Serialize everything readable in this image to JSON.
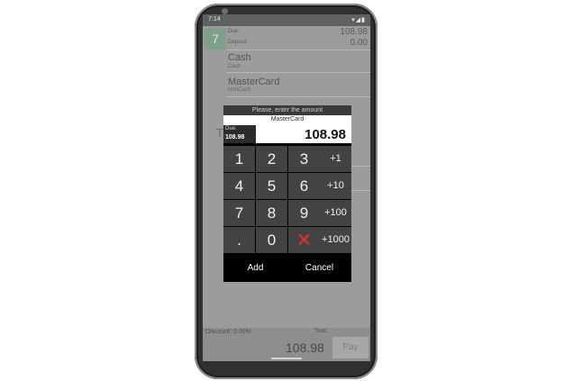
{
  "status": {
    "time": "7:14",
    "icons": "▾◢▮"
  },
  "back": {
    "label": "7"
  },
  "summary": {
    "due_label": "Due:",
    "due_value": "108.98",
    "deposit_label": "Deposit:",
    "deposit_value": "0.00"
  },
  "payment_methods": [
    {
      "name": "Cash",
      "type": "Cash"
    },
    {
      "name": "MasterCard",
      "type": "NonCash"
    }
  ],
  "background_letter": "T",
  "footer": {
    "discount_label": "Discount: 0.00%",
    "total_label": "Total:",
    "total_value": "108.98",
    "pay_label": "Pay"
  },
  "dialog": {
    "title": "Please, enter the amount",
    "card_name": "MasterCard",
    "due_label": "Due:",
    "due_value": "108.98",
    "amount": "108.98",
    "keys": [
      "1",
      "2",
      "3",
      "+1",
      "4",
      "5",
      "6",
      "+10",
      "7",
      "8",
      "9",
      "+100",
      ".",
      "0",
      "✕",
      "+1000"
    ],
    "add_label": "Add",
    "cancel_label": "Cancel"
  },
  "colors": {
    "delete_key": "#e03030",
    "back_tile": "#7fa08a"
  }
}
